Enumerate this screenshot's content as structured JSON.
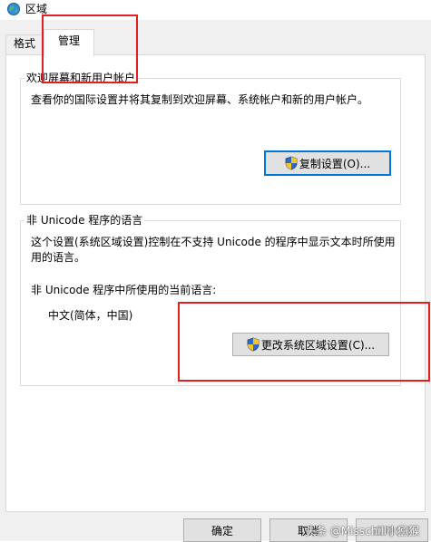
{
  "window": {
    "title": "区域",
    "icon": "globe-icon"
  },
  "tabs": [
    {
      "label": "格式",
      "active": false
    },
    {
      "label": "管理",
      "active": true
    }
  ],
  "welcome_group": {
    "legend": "欢迎屏幕和新用户帐户",
    "description": "查看你的国际设置并将其复制到欢迎屏幕、系统帐户和新的用户帐户。",
    "button_label": "复制设置(O)...",
    "button_icon": "uac-shield-icon"
  },
  "unicode_group": {
    "legend": "非 Unicode 程序的语言",
    "description_line1": "这个设置(系统区域设置)控制在不支持 Unicode 的程序中显示文本时所使用",
    "description_line2": "用的语言。",
    "current_label": "非 Unicode 程序中所使用的当前语言:",
    "current_value": "中文(简体，中国)",
    "button_label": "更改系统区域设置(C)...",
    "button_icon": "uac-shield-icon"
  },
  "footer": {
    "ok_label": "确定",
    "cancel_label": "取消",
    "apply_label": "应用(A)"
  },
  "watermark": "头条 @Misschill小猕猴",
  "colors": {
    "highlight": "#e02020",
    "focus_border": "#0078d7",
    "dialog_bg": "#f0f0f0",
    "panel_bg": "#ffffff"
  }
}
